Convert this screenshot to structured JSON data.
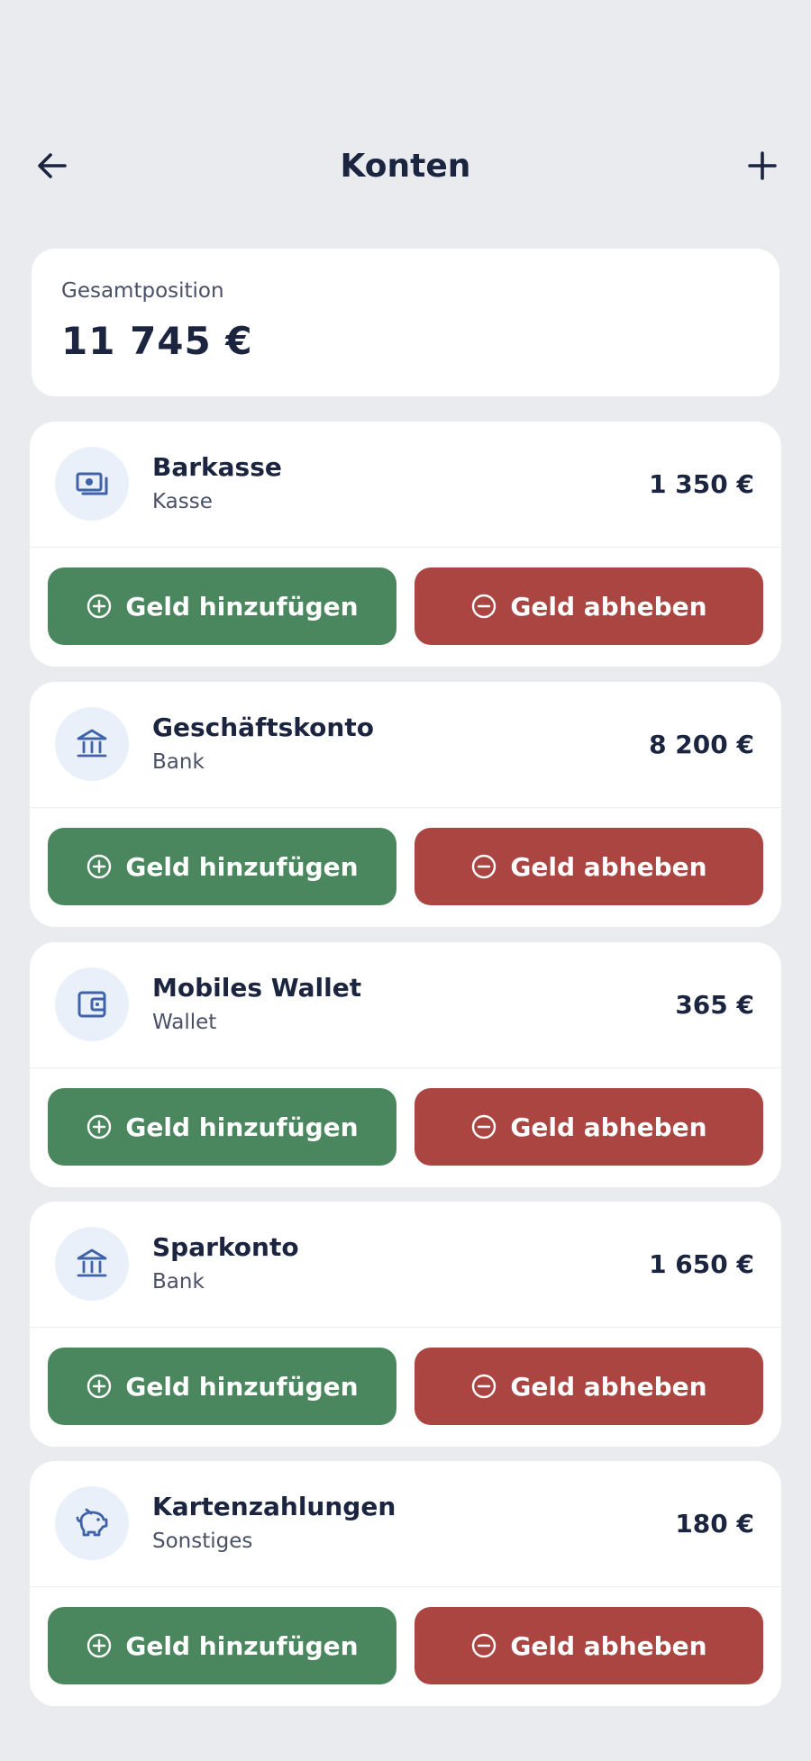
{
  "header": {
    "title": "Konten",
    "back_icon": "arrow-left-icon",
    "add_icon": "plus-icon"
  },
  "total": {
    "label": "Gesamtposition",
    "value": "11 745 €"
  },
  "accounts": [
    {
      "name": "Barkasse",
      "type": "Kasse",
      "balance": "1 350 €",
      "icon": "cash-icon"
    },
    {
      "name": "Geschäftskonto",
      "type": "Bank",
      "balance": "8 200 €",
      "icon": "bank-icon"
    },
    {
      "name": "Mobiles Wallet",
      "type": "Wallet",
      "balance": "365 €",
      "icon": "wallet-icon"
    },
    {
      "name": "Sparkonto",
      "type": "Bank",
      "balance": "1 650 €",
      "icon": "bank-icon"
    },
    {
      "name": "Kartenzahlungen",
      "type": "Sonstiges",
      "balance": "180 €",
      "icon": "piggy-bank-icon"
    }
  ],
  "buttons": {
    "add_label": "Geld hinzufügen",
    "withdraw_label": "Geld abheben"
  },
  "colors": {
    "background": "#E9EBEF",
    "add_button": "#4A875E",
    "withdraw_button": "#AA4542",
    "icon_accent": "#3F63A8",
    "icon_bg": "#EAF0FA",
    "text_primary": "#1C2540"
  }
}
